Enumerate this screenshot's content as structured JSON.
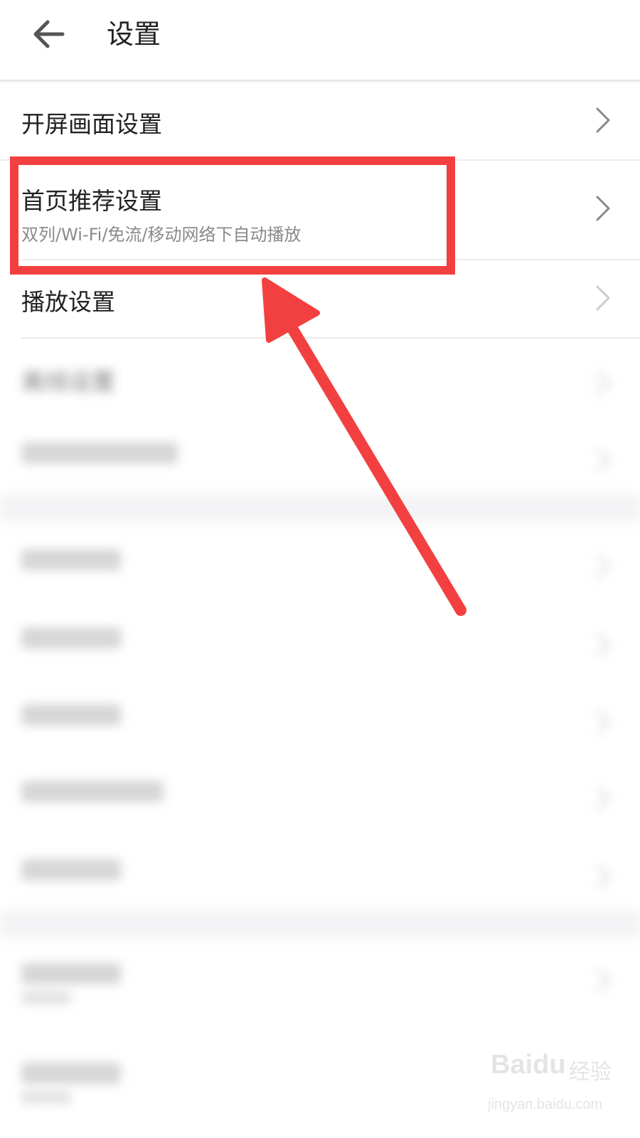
{
  "header": {
    "title": "设置",
    "back_icon": "arrow-left-icon"
  },
  "settings": {
    "items": [
      {
        "label": "开屏画面设置",
        "sub": ""
      },
      {
        "label": "首页推荐设置",
        "sub": "双列/Wi-Fi/免流/移动网络下自动播放"
      },
      {
        "label": "播放设置",
        "sub": ""
      }
    ],
    "chevron_icon": "chevron-right-icon"
  },
  "blurred_items": {
    "visible_fragment": "离线设置"
  },
  "watermark": {
    "brand": "Baidu",
    "cn": "经验",
    "url": "jingyan.baidu.com"
  },
  "colors": {
    "annotation_red": "#f24040",
    "text_primary": "#222222",
    "text_secondary": "#8a8a8a",
    "divider": "#ececec"
  }
}
